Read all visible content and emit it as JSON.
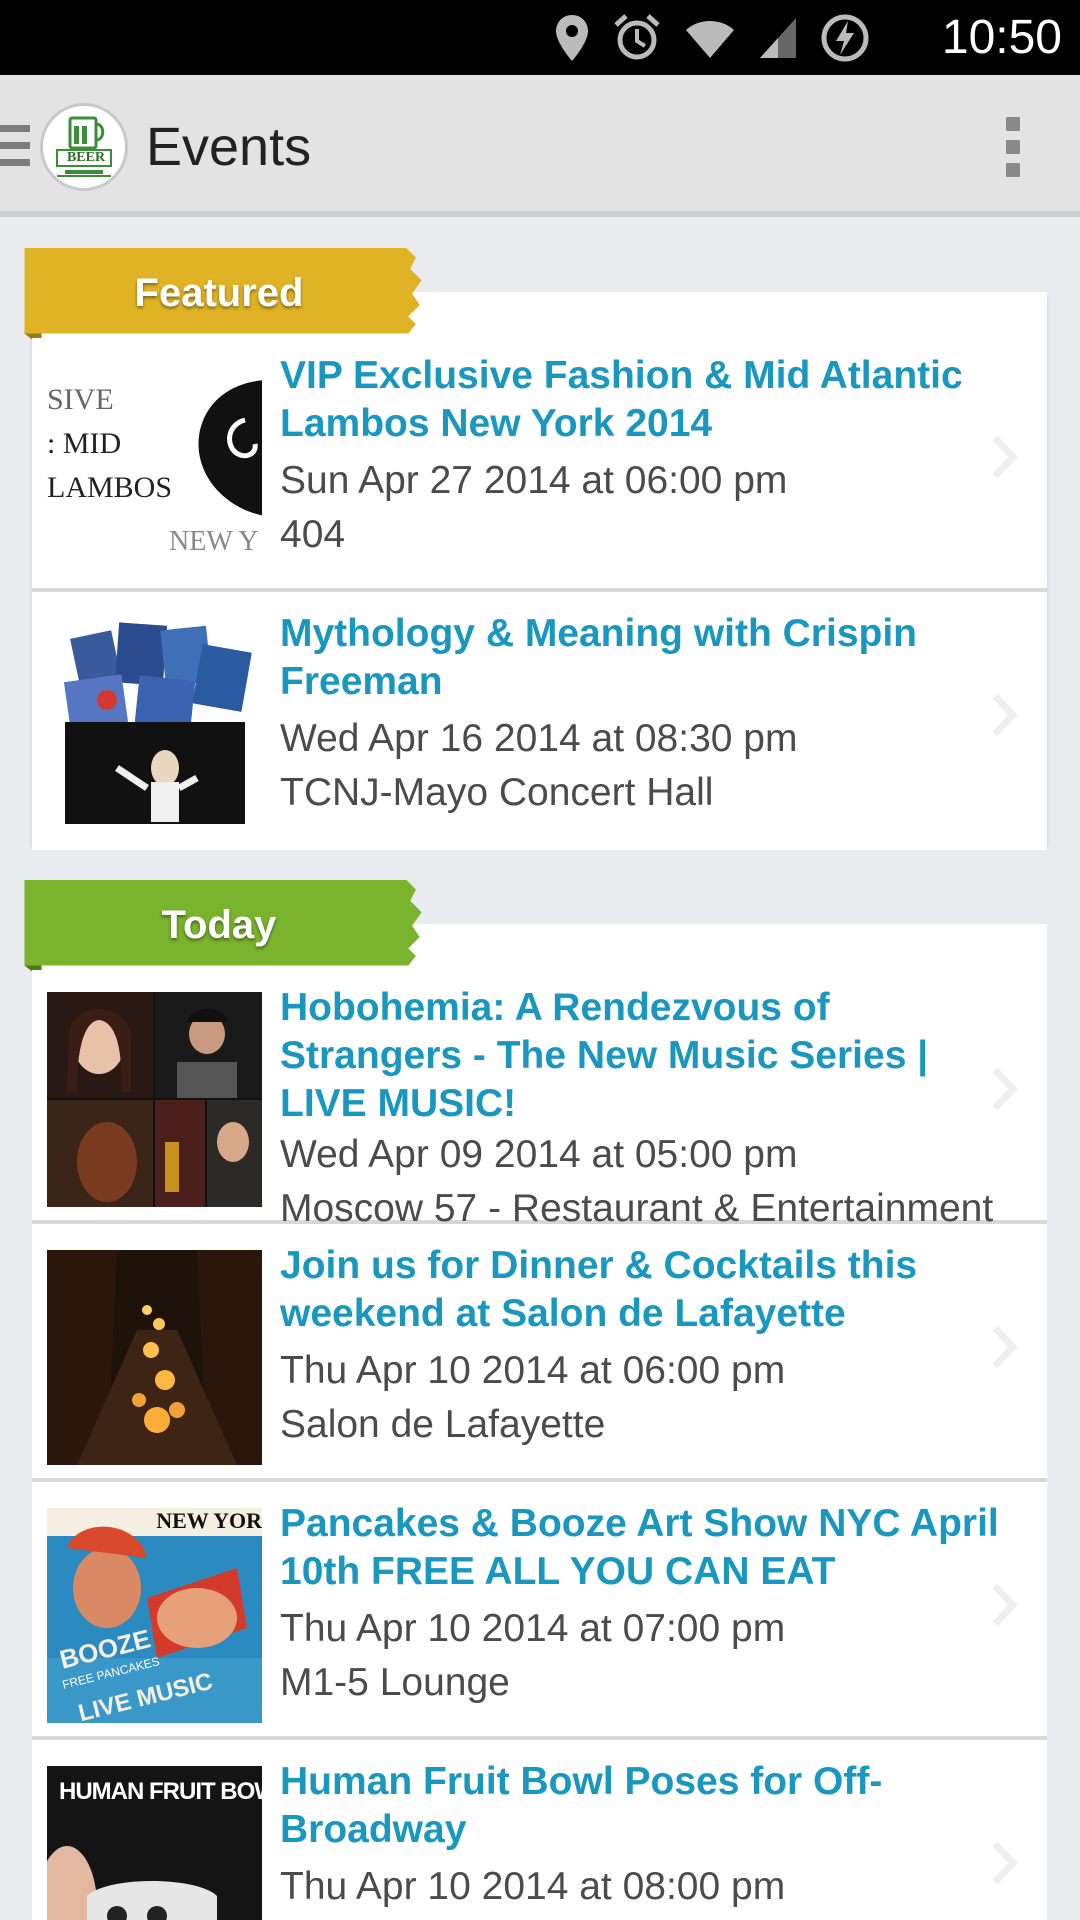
{
  "status_bar": {
    "time": "10:50",
    "icons": [
      "location-icon",
      "alarm-icon",
      "wifi-icon",
      "signal-icon",
      "battery-charging-icon"
    ]
  },
  "action_bar": {
    "logo_text": "BEER",
    "title": "Events"
  },
  "sections": [
    {
      "label": "Featured",
      "ribbon_color": "#e0b326",
      "events": [
        {
          "title": "VIP Exclusive Fashion & Mid Atlantic Lambos New York 2014",
          "date": "Sun Apr 27 2014 at 06:00 pm",
          "venue": "404",
          "thumb_text": [
            "SIVE",
            ": MID",
            "LAMBOS",
            "NEW Y"
          ]
        },
        {
          "title": "Mythology & Meaning with Crispin Freeman",
          "date": "Wed Apr 16 2014 at 08:30 pm",
          "venue": "TCNJ-Mayo Concert Hall"
        }
      ]
    },
    {
      "label": "Today",
      "ribbon_color": "#7ab32e",
      "events": [
        {
          "title": "Hobohemia: A Rendezvous of Strangers - The New Music Series | LIVE MUSIC!",
          "date": "Wed Apr 09 2014 at 05:00 pm",
          "venue": "Moscow 57 - Restaurant & Entertainment"
        },
        {
          "title": "Join us for Dinner & Cocktails this weekend at Salon de Lafayette",
          "date": "Thu Apr 10 2014 at 06:00 pm",
          "venue": "Salon de Lafayette"
        },
        {
          "title": "Pancakes & Booze Art Show NYC April 10th FREE ALL YOU CAN EAT",
          "date": "Thu Apr 10 2014 at 07:00 pm",
          "venue": "M1-5 Lounge",
          "thumb_text": [
            "NEW YOR",
            "BOOZE",
            "FREE PANCAKES",
            "LIVE MUSIC"
          ]
        },
        {
          "title": "Human Fruit Bowl Poses for Off-Broadway",
          "date": "Thu Apr 10 2014 at 08:00 pm",
          "venue": "",
          "thumb_text": [
            "HUMAN FRUIT BOW"
          ]
        }
      ]
    }
  ],
  "colors": {
    "accent_title": "#1a97bf",
    "body_text": "#4b4b4b",
    "background": "#e9ebee"
  }
}
